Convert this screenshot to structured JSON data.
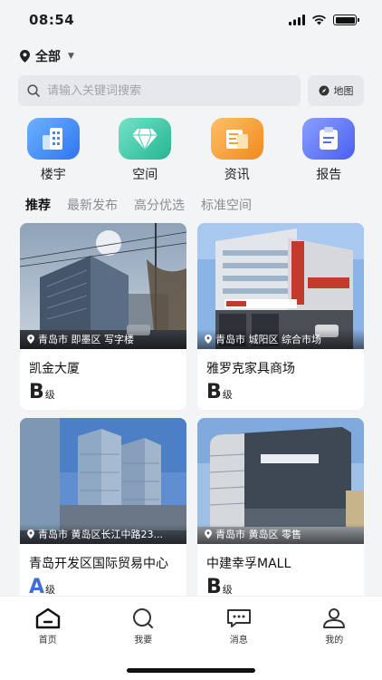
{
  "status_bar": {
    "time": "08:54",
    "battery_level": 1.0
  },
  "location": {
    "label": "全部"
  },
  "search": {
    "placeholder": "请输入关键词搜索",
    "map_label": "地图"
  },
  "categories": [
    {
      "label": "楼宇",
      "icon": "building-icon",
      "color": "#3f8ef7"
    },
    {
      "label": "空间",
      "icon": "diamond-icon",
      "color": "#37c5a8"
    },
    {
      "label": "资讯",
      "icon": "news-icon",
      "color": "#f5a033"
    },
    {
      "label": "报告",
      "icon": "report-icon",
      "color": "#4f6ef7"
    }
  ],
  "tabs": [
    {
      "label": "推荐",
      "active": true
    },
    {
      "label": "最新发布",
      "active": false
    },
    {
      "label": "高分优选",
      "active": false
    },
    {
      "label": "标准空间",
      "active": false
    }
  ],
  "listings": [
    {
      "tag": "青岛市 即墨区 写字楼",
      "title": "凯金大厦",
      "grade": "B",
      "grade_suffix": "级"
    },
    {
      "tag": "青岛市 城阳区 综合市场",
      "title": "雅罗克家具商场",
      "grade": "B",
      "grade_suffix": "级"
    },
    {
      "tag": "青岛市 黄岛区长江中路23...",
      "title": "青岛开发区国际贸易中心",
      "grade": "A",
      "grade_suffix": "级"
    },
    {
      "tag": "青岛市 黄岛区 零售",
      "title": "中建幸孚MALL",
      "grade": "B",
      "grade_suffix": "级"
    }
  ],
  "bottom_nav": [
    {
      "label": "首页",
      "icon": "home-icon",
      "active": true
    },
    {
      "label": "我要",
      "icon": "search-icon",
      "active": false
    },
    {
      "label": "消息",
      "icon": "message-icon",
      "active": false
    },
    {
      "label": "我的",
      "icon": "profile-icon",
      "active": false
    }
  ],
  "colors": {
    "accent": "#3f6fd6",
    "background": "#f3f4f6"
  }
}
